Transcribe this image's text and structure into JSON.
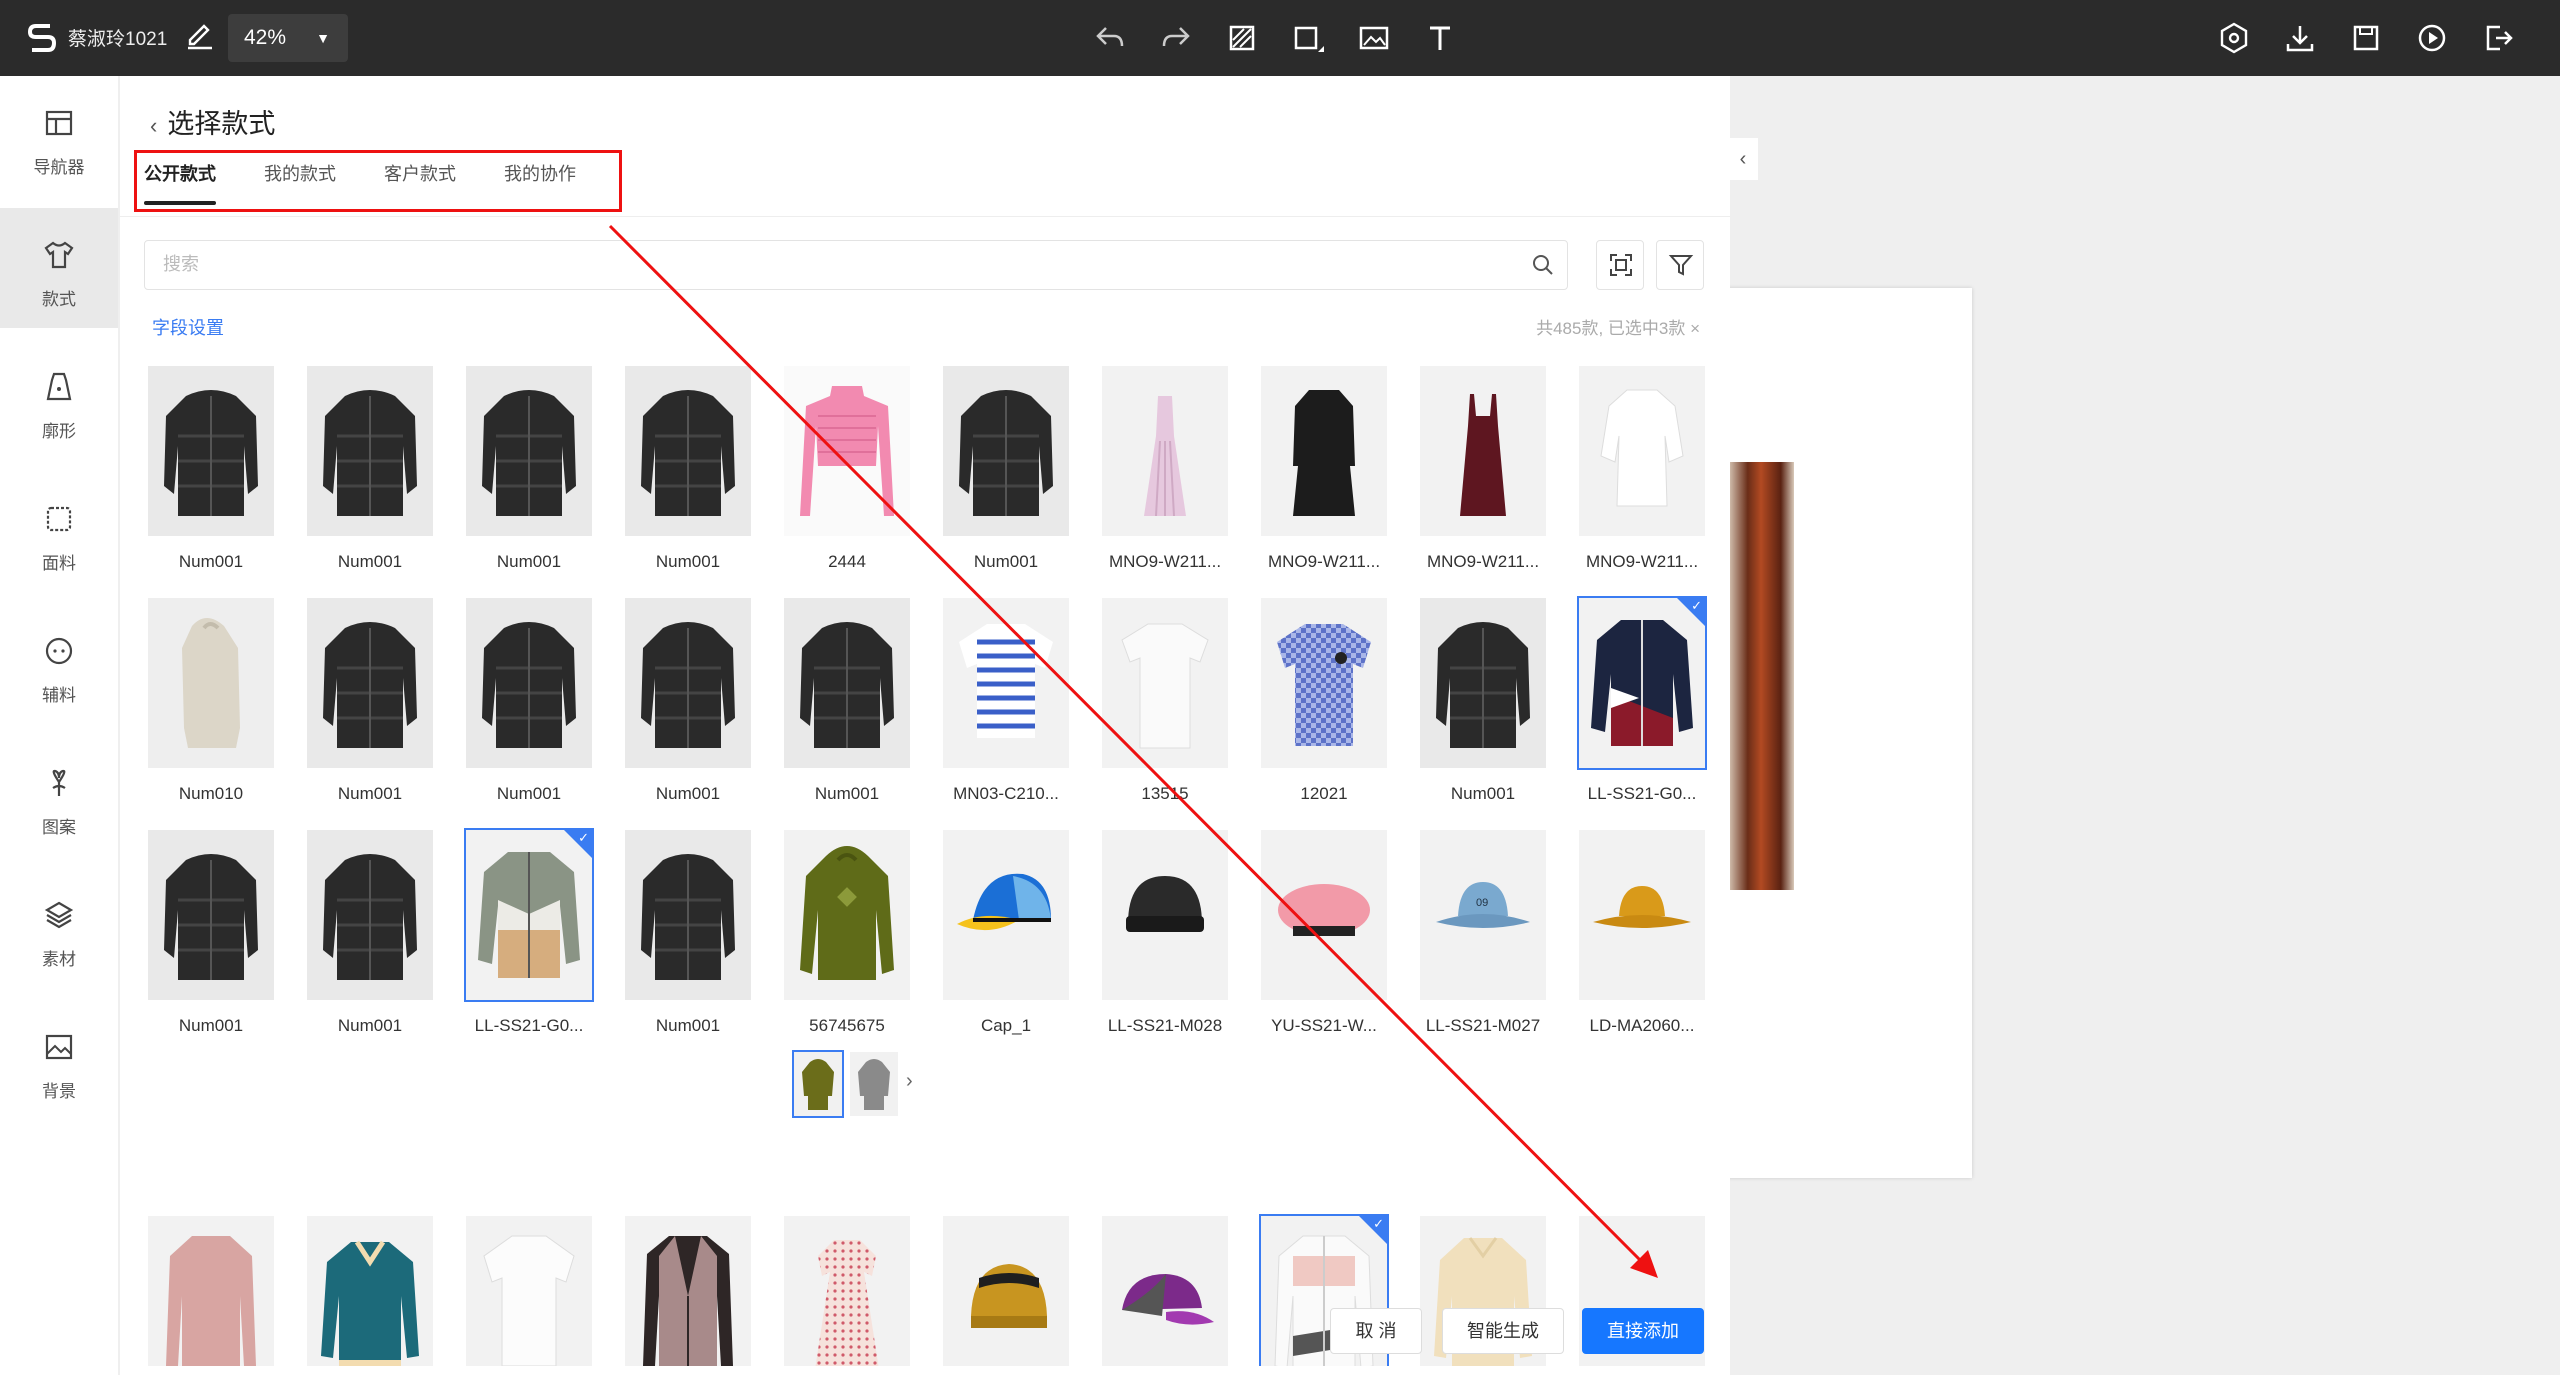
{
  "topbar": {
    "username": "蔡淑玲1021",
    "zoom": "42%",
    "tools_center": [
      "undo-icon",
      "redo-icon",
      "eraser-icon",
      "rectangle-icon",
      "image-icon",
      "text-icon"
    ],
    "tools_right": [
      "preview-icon",
      "download-icon",
      "save-icon",
      "play-icon",
      "exit-icon"
    ]
  },
  "sidebar": {
    "items": [
      {
        "label": "导航器",
        "icon": "navigator-icon"
      },
      {
        "label": "款式",
        "icon": "tshirt-icon"
      },
      {
        "label": "廓形",
        "icon": "silhouette-icon"
      },
      {
        "label": "面料",
        "icon": "fabric-icon"
      },
      {
        "label": "辅料",
        "icon": "button-icon"
      },
      {
        "label": "图案",
        "icon": "pattern-icon"
      },
      {
        "label": "素材",
        "icon": "layers-icon"
      },
      {
        "label": "背景",
        "icon": "background-icon"
      }
    ],
    "active": "款式"
  },
  "panel": {
    "back_title": "选择款式",
    "tabs": [
      {
        "label": "公开款式",
        "active": true
      },
      {
        "label": "我的款式",
        "active": false
      },
      {
        "label": "客户款式",
        "active": false
      },
      {
        "label": "我的协作",
        "active": false
      }
    ],
    "search_placeholder": "搜索",
    "field_settings": "字段设置",
    "count_text": "共485款, 已选中3款 ×",
    "rows": [
      [
        {
          "name": "Num001",
          "type": "puffer",
          "selected": false
        },
        {
          "name": "Num001",
          "type": "puffer",
          "selected": false
        },
        {
          "name": "Num001",
          "type": "puffer",
          "selected": false
        },
        {
          "name": "Num001",
          "type": "puffer",
          "selected": false
        },
        {
          "name": "2444",
          "type": "pinktop",
          "selected": false
        },
        {
          "name": "Num001",
          "type": "puffer",
          "selected": false
        },
        {
          "name": "MNO9-W211...",
          "type": "pinkdress",
          "selected": false
        },
        {
          "name": "MNO9-W211...",
          "type": "blackdress",
          "selected": false
        },
        {
          "name": "MNO9-W211...",
          "type": "reddress",
          "selected": false
        },
        {
          "name": "MNO9-W211...",
          "type": "whiteblouse",
          "selected": false
        }
      ],
      [
        {
          "name": "Num010",
          "type": "hoodie",
          "selected": false
        },
        {
          "name": "Num001",
          "type": "puffer",
          "selected": false
        },
        {
          "name": "Num001",
          "type": "puffer",
          "selected": false
        },
        {
          "name": "Num001",
          "type": "puffer",
          "selected": false
        },
        {
          "name": "Num001",
          "type": "puffer",
          "selected": false
        },
        {
          "name": "MN03-C210...",
          "type": "stripe",
          "selected": false
        },
        {
          "name": "13515",
          "type": "whitetee",
          "selected": false
        },
        {
          "name": "12021",
          "type": "checktee",
          "selected": false
        },
        {
          "name": "Num001",
          "type": "puffer",
          "selected": false
        },
        {
          "name": "LL-SS21-G0...",
          "type": "jacket1",
          "selected": true
        }
      ],
      [
        {
          "name": "Num001",
          "type": "puffer",
          "selected": false
        },
        {
          "name": "Num001",
          "type": "puffer",
          "selected": false
        },
        {
          "name": "LL-SS21-G0...",
          "type": "jacket2",
          "selected": true
        },
        {
          "name": "Num001",
          "type": "puffer",
          "selected": false
        },
        {
          "name": "56745675",
          "type": "greenhoodie",
          "selected": false
        },
        {
          "name": "Cap_1",
          "type": "cap",
          "selected": false
        },
        {
          "name": "LL-SS21-M028",
          "type": "beanie",
          "selected": false
        },
        {
          "name": "YU-SS21-W...",
          "type": "beret",
          "selected": false
        },
        {
          "name": "LL-SS21-M027",
          "type": "bucket",
          "selected": false
        },
        {
          "name": "LD-MA2060...",
          "type": "yellowhat",
          "selected": false
        }
      ],
      [
        {
          "name": "",
          "type": "pinkcoat",
          "selected": false
        },
        {
          "name": "",
          "type": "tealsweater",
          "selected": false
        },
        {
          "name": "",
          "type": "whiteshirt",
          "selected": false
        },
        {
          "name": "",
          "type": "blazer",
          "selected": false
        },
        {
          "name": "",
          "type": "floraldress",
          "selected": false
        },
        {
          "name": "",
          "type": "truckercap",
          "selected": false
        },
        {
          "name": "",
          "type": "purplecap",
          "selected": false
        },
        {
          "name": "",
          "type": "windbreaker",
          "selected": true
        },
        {
          "name": "",
          "type": "creamsweater",
          "selected": false
        },
        {
          "name": "",
          "type": "empty",
          "selected": false
        }
      ]
    ],
    "cancel": "取 消",
    "smart_generate": "智能生成",
    "direct_add": "直接添加"
  },
  "colors": {
    "accent": "#1677ff",
    "annotation_red": "#e11111",
    "topbar_bg": "#2b2b2b"
  }
}
